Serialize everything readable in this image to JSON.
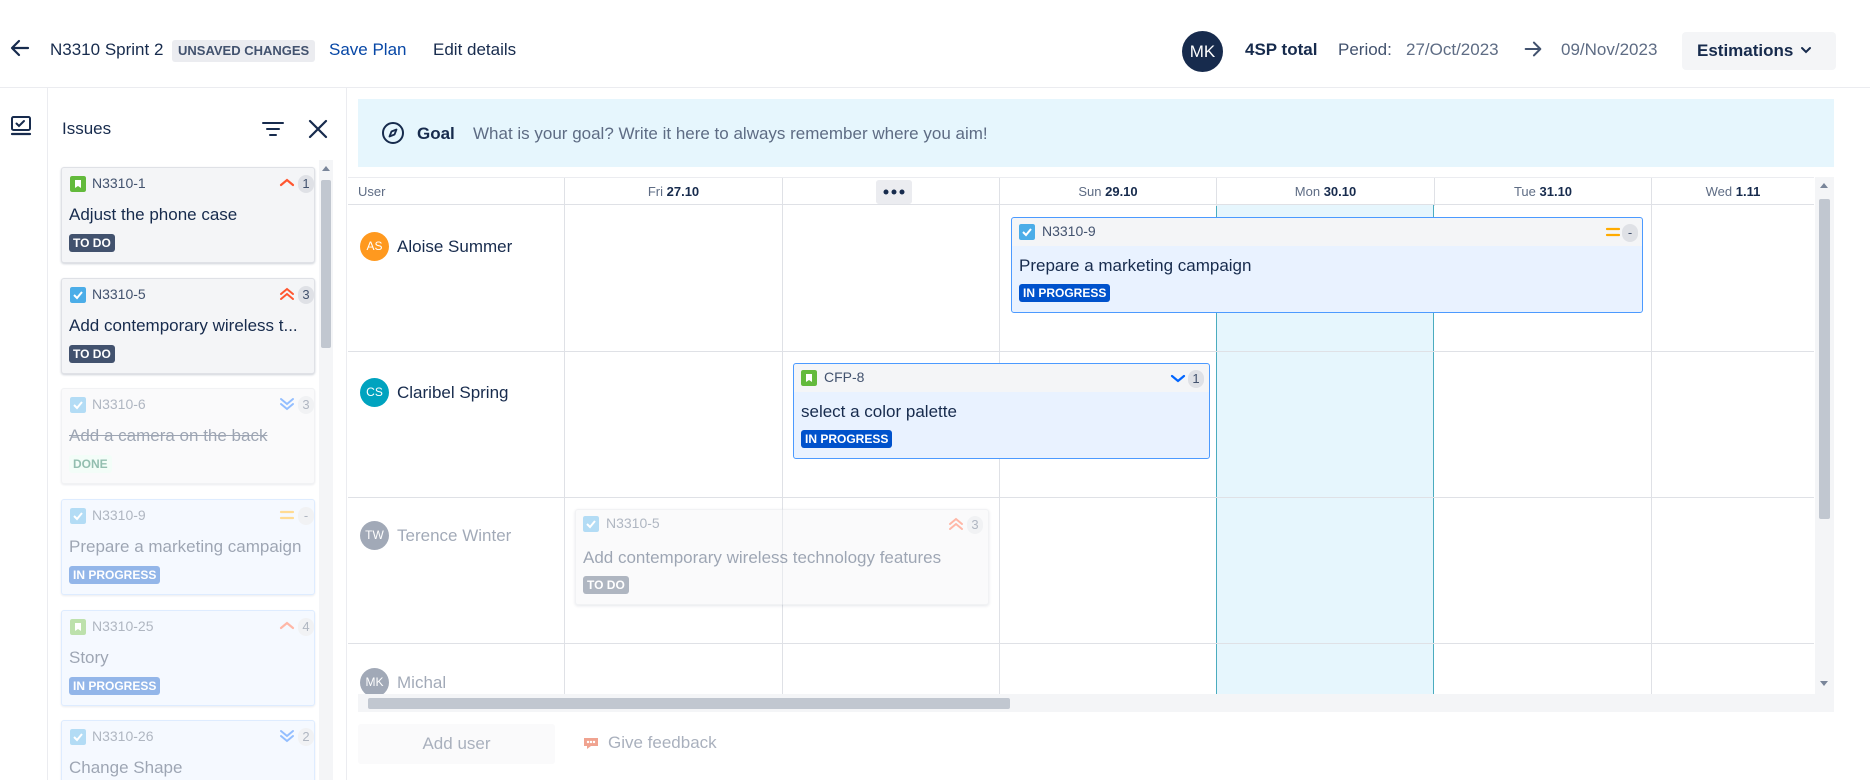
{
  "topbar": {
    "plan_name": "N3310 Sprint 2",
    "unsaved_badge": "UNSAVED CHANGES",
    "save_plan": "Save Plan",
    "edit_details": "Edit details",
    "avatar_initials": "MK",
    "sp_total": "4SP total",
    "period_label": "Period:",
    "period_start": "27/Oct/2023",
    "period_end": "09/Nov/2023",
    "estimations": "Estimations"
  },
  "issues_panel": {
    "title": "Issues",
    "items": [
      {
        "key": "N3310-1",
        "summary": "Adjust the phone case",
        "status": "TO DO",
        "sp": "1",
        "type": "story",
        "priority": "high"
      },
      {
        "key": "N3310-5",
        "summary": "Add contemporary wireless t...",
        "status": "TO DO",
        "sp": "3",
        "type": "task",
        "priority": "highest"
      },
      {
        "key": "N3310-6",
        "summary": "Add a camera on the back",
        "status": "DONE",
        "sp": "3",
        "type": "task",
        "priority": "lowest"
      },
      {
        "key": "N3310-9",
        "summary": "Prepare a marketing campaign",
        "status": "IN PROGRESS",
        "sp": "-",
        "type": "task",
        "priority": "medium"
      },
      {
        "key": "N3310-25",
        "summary": "Story",
        "status": "IN PROGRESS",
        "sp": "4",
        "type": "story",
        "priority": "high"
      },
      {
        "key": "N3310-26",
        "summary": "Change Shape",
        "status": "",
        "sp": "2",
        "type": "task",
        "priority": "lowest"
      }
    ]
  },
  "goal": {
    "label": "Goal",
    "placeholder": "What is your goal? Write it here to always remember where you aim!"
  },
  "grid": {
    "user_header": "User",
    "columns": [
      {
        "day": "Fri",
        "date": "27.10"
      },
      {
        "day": "",
        "date": ""
      },
      {
        "day": "Sun",
        "date": "29.10"
      },
      {
        "day": "Mon",
        "date": "30.10"
      },
      {
        "day": "Tue",
        "date": "31.10"
      },
      {
        "day": "Wed",
        "date": "1.11"
      }
    ],
    "users": [
      {
        "initials": "AS",
        "name": "Aloise Summer",
        "color": "#ff991f"
      },
      {
        "initials": "CS",
        "name": "Claribel Spring",
        "color": "#00a3bf"
      },
      {
        "initials": "TW",
        "name": "Terence Winter",
        "color": "#172b4d"
      },
      {
        "initials": "MK",
        "name": "Michal",
        "color": "#172b4d"
      }
    ],
    "tasks": [
      {
        "key": "N3310-9",
        "summary": "Prepare a marketing campaign",
        "status": "IN PROGRESS",
        "sp": "-"
      },
      {
        "key": "CFP-8",
        "summary": "select a color palette",
        "status": "IN PROGRESS",
        "sp": "1"
      },
      {
        "key": "N3310-5",
        "summary": "Add contemporary wireless technology features",
        "status": "TO DO",
        "sp": "3"
      }
    ]
  },
  "footer": {
    "add_user": "Add user",
    "give_feedback": "Give feedback"
  },
  "colors": {
    "brand_blue": "#0052cc",
    "today_highlight": "#e6f6fd",
    "story_green": "#63ba3c",
    "task_blue": "#4bade8"
  }
}
